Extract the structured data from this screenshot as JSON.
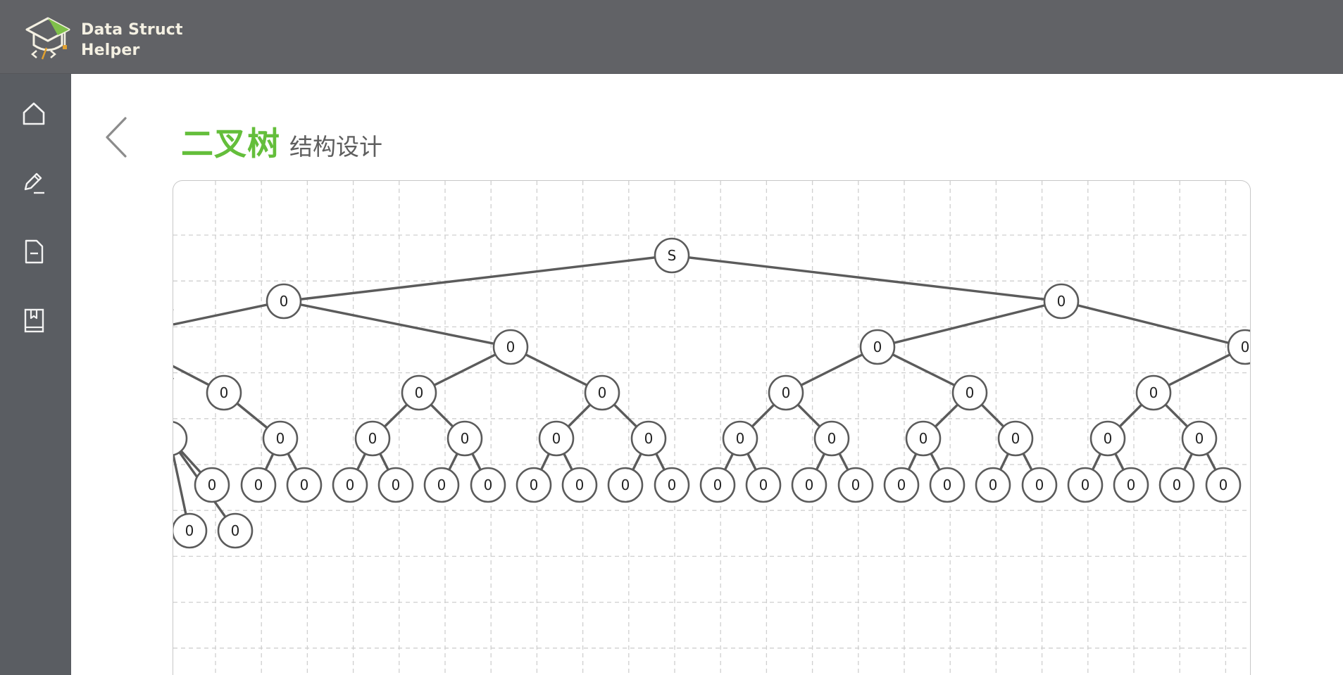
{
  "app": {
    "brand_line1": "Data Struct",
    "brand_line2": "Helper"
  },
  "sidebar": {
    "items": [
      {
        "icon": "home-icon"
      },
      {
        "icon": "edit-icon"
      },
      {
        "icon": "document-icon"
      },
      {
        "icon": "book-icon"
      }
    ]
  },
  "page": {
    "title": "二叉树",
    "subtitle": "结构设计"
  },
  "colors": {
    "topbar": "#616266",
    "sidebar": "#5a5d62",
    "accent": "#64be3b",
    "node_stroke": "#5b5b5b",
    "grid": "#cfcfcf"
  },
  "tree": {
    "root_label": "S",
    "node_label": "0"
  }
}
